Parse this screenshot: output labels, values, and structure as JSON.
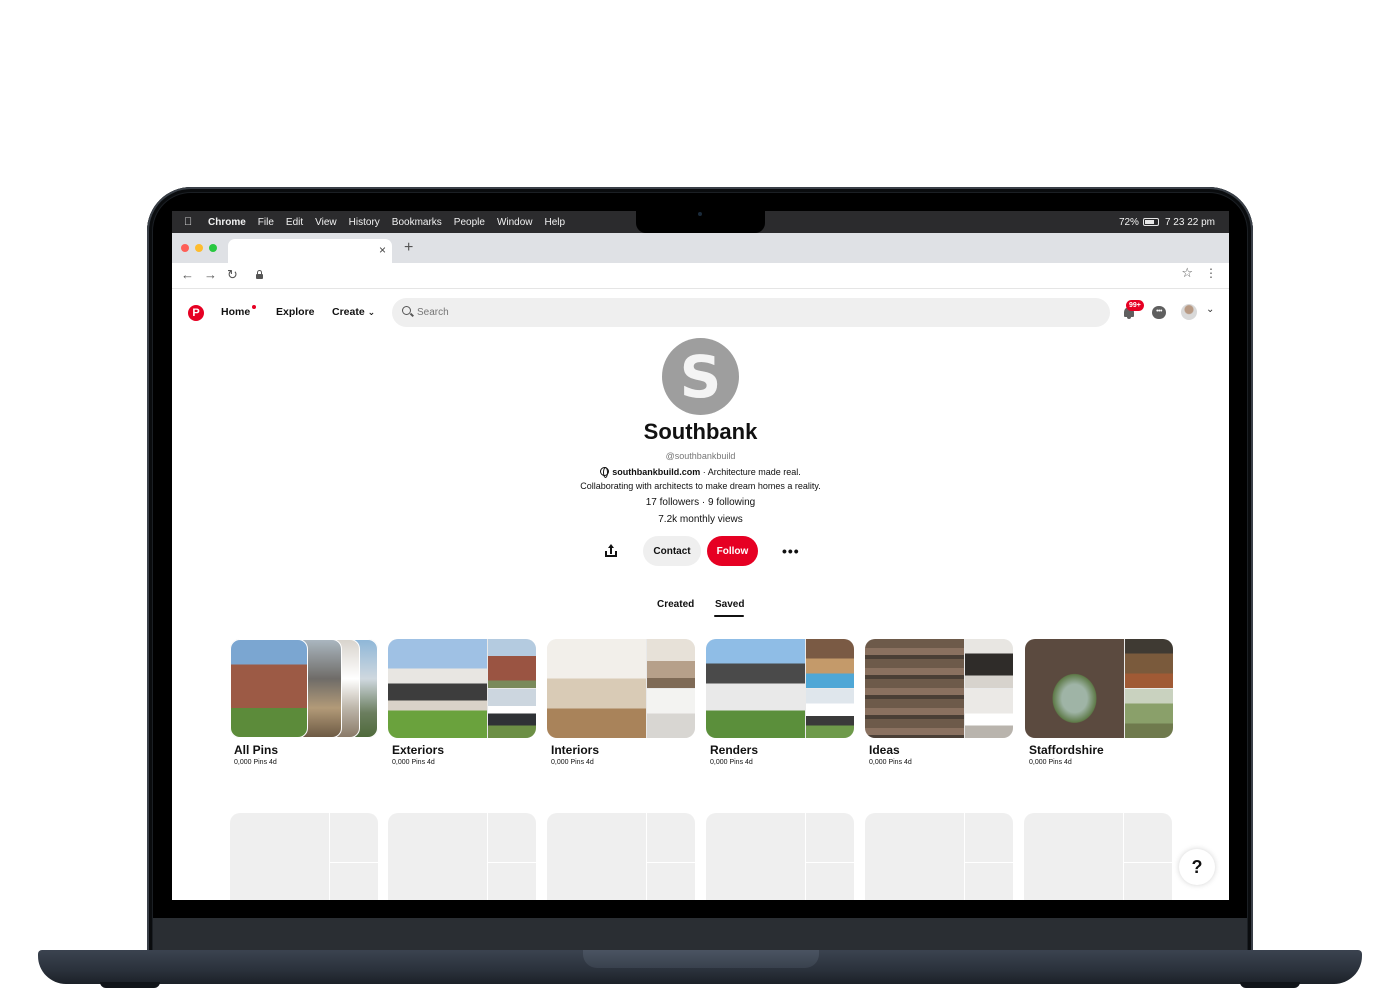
{
  "menubar": {
    "items": [
      "Chrome",
      "File",
      "Edit",
      "View",
      "History",
      "Bookmarks",
      "People",
      "Window",
      "Help"
    ],
    "battery": "72%",
    "time": "7 23 22 pm"
  },
  "browser": {
    "tab_close": "×",
    "new_tab": "+"
  },
  "pinterest": {
    "nav": {
      "home": "Home",
      "explore": "Explore",
      "create": "Create"
    },
    "search_placeholder": "Search",
    "notifications_badge": "99+"
  },
  "profile": {
    "avatar_letter": "S",
    "name": "Southbank",
    "handle": "@southbankbuild",
    "website": "southbankbuild.com",
    "tagline": "Architecture made real.",
    "bio": "Collaborating with architects to make dream homes a reality.",
    "followers": "17 followers",
    "following": "9 following",
    "monthly_views": "7.2k monthly views",
    "contact_label": "Contact",
    "follow_label": "Follow"
  },
  "tabs": {
    "created": "Created",
    "saved": "Saved",
    "active": "Saved"
  },
  "boards": [
    {
      "title": "All Pins",
      "meta": "0,000 Pins  4d"
    },
    {
      "title": "Exteriors",
      "meta": "0,000 Pins  4d"
    },
    {
      "title": "Interiors",
      "meta": "0,000 Pins  4d"
    },
    {
      "title": "Renders",
      "meta": "0,000 Pins  4d"
    },
    {
      "title": "Ideas",
      "meta": "0,000 Pins  4d"
    },
    {
      "title": "Staffordshire",
      "meta": "0,000 Pins  4d"
    }
  ],
  "help_label": "?",
  "colors": {
    "brand_red": "#e60023",
    "menubar": "#2b2b2d",
    "tabstrip": "#dfe1e5",
    "laptop_body": "#1b1f24"
  }
}
